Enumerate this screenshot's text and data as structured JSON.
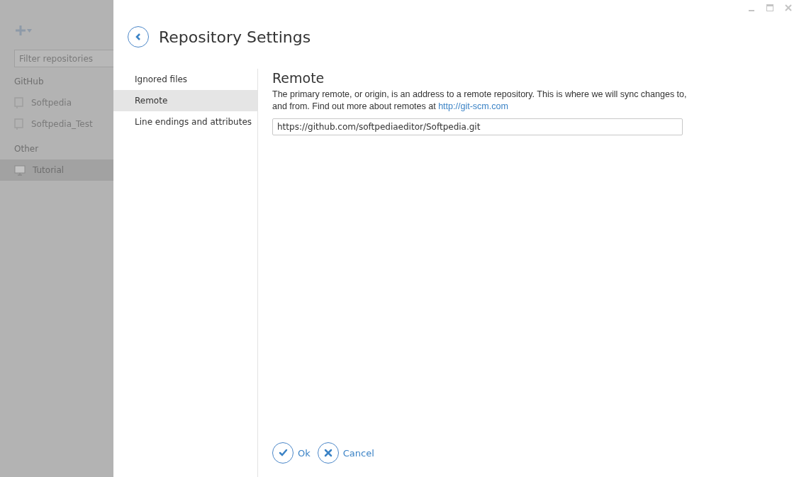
{
  "sidebar": {
    "filter": {
      "placeholder": "Filter repositories"
    },
    "groups": [
      {
        "label": "GitHub",
        "items": [
          {
            "label": "Softpedia",
            "kind": "repo",
            "selected": false
          },
          {
            "label": "Softpedia_Test",
            "kind": "repo",
            "selected": false
          }
        ]
      },
      {
        "label": "Other",
        "items": [
          {
            "label": "Tutorial",
            "kind": "local",
            "selected": true
          }
        ]
      }
    ]
  },
  "title": "Repository Settings",
  "nav": [
    {
      "label": "Ignored files",
      "selected": false
    },
    {
      "label": "Remote",
      "selected": true
    },
    {
      "label": "Line endings and attributes",
      "selected": false
    }
  ],
  "section": {
    "heading": "Remote",
    "description": "The primary remote, or origin, is an address to a remote repository. This is where we will sync changes to, and from. Find out more about remotes at",
    "link": "http://git-scm.com",
    "value": "https://github.com/softpediaeditor/Softpedia.git"
  },
  "buttons": [
    {
      "label": "Ok",
      "kind": "ok"
    },
    {
      "label": "Cancel",
      "kind": "cancel"
    }
  ]
}
